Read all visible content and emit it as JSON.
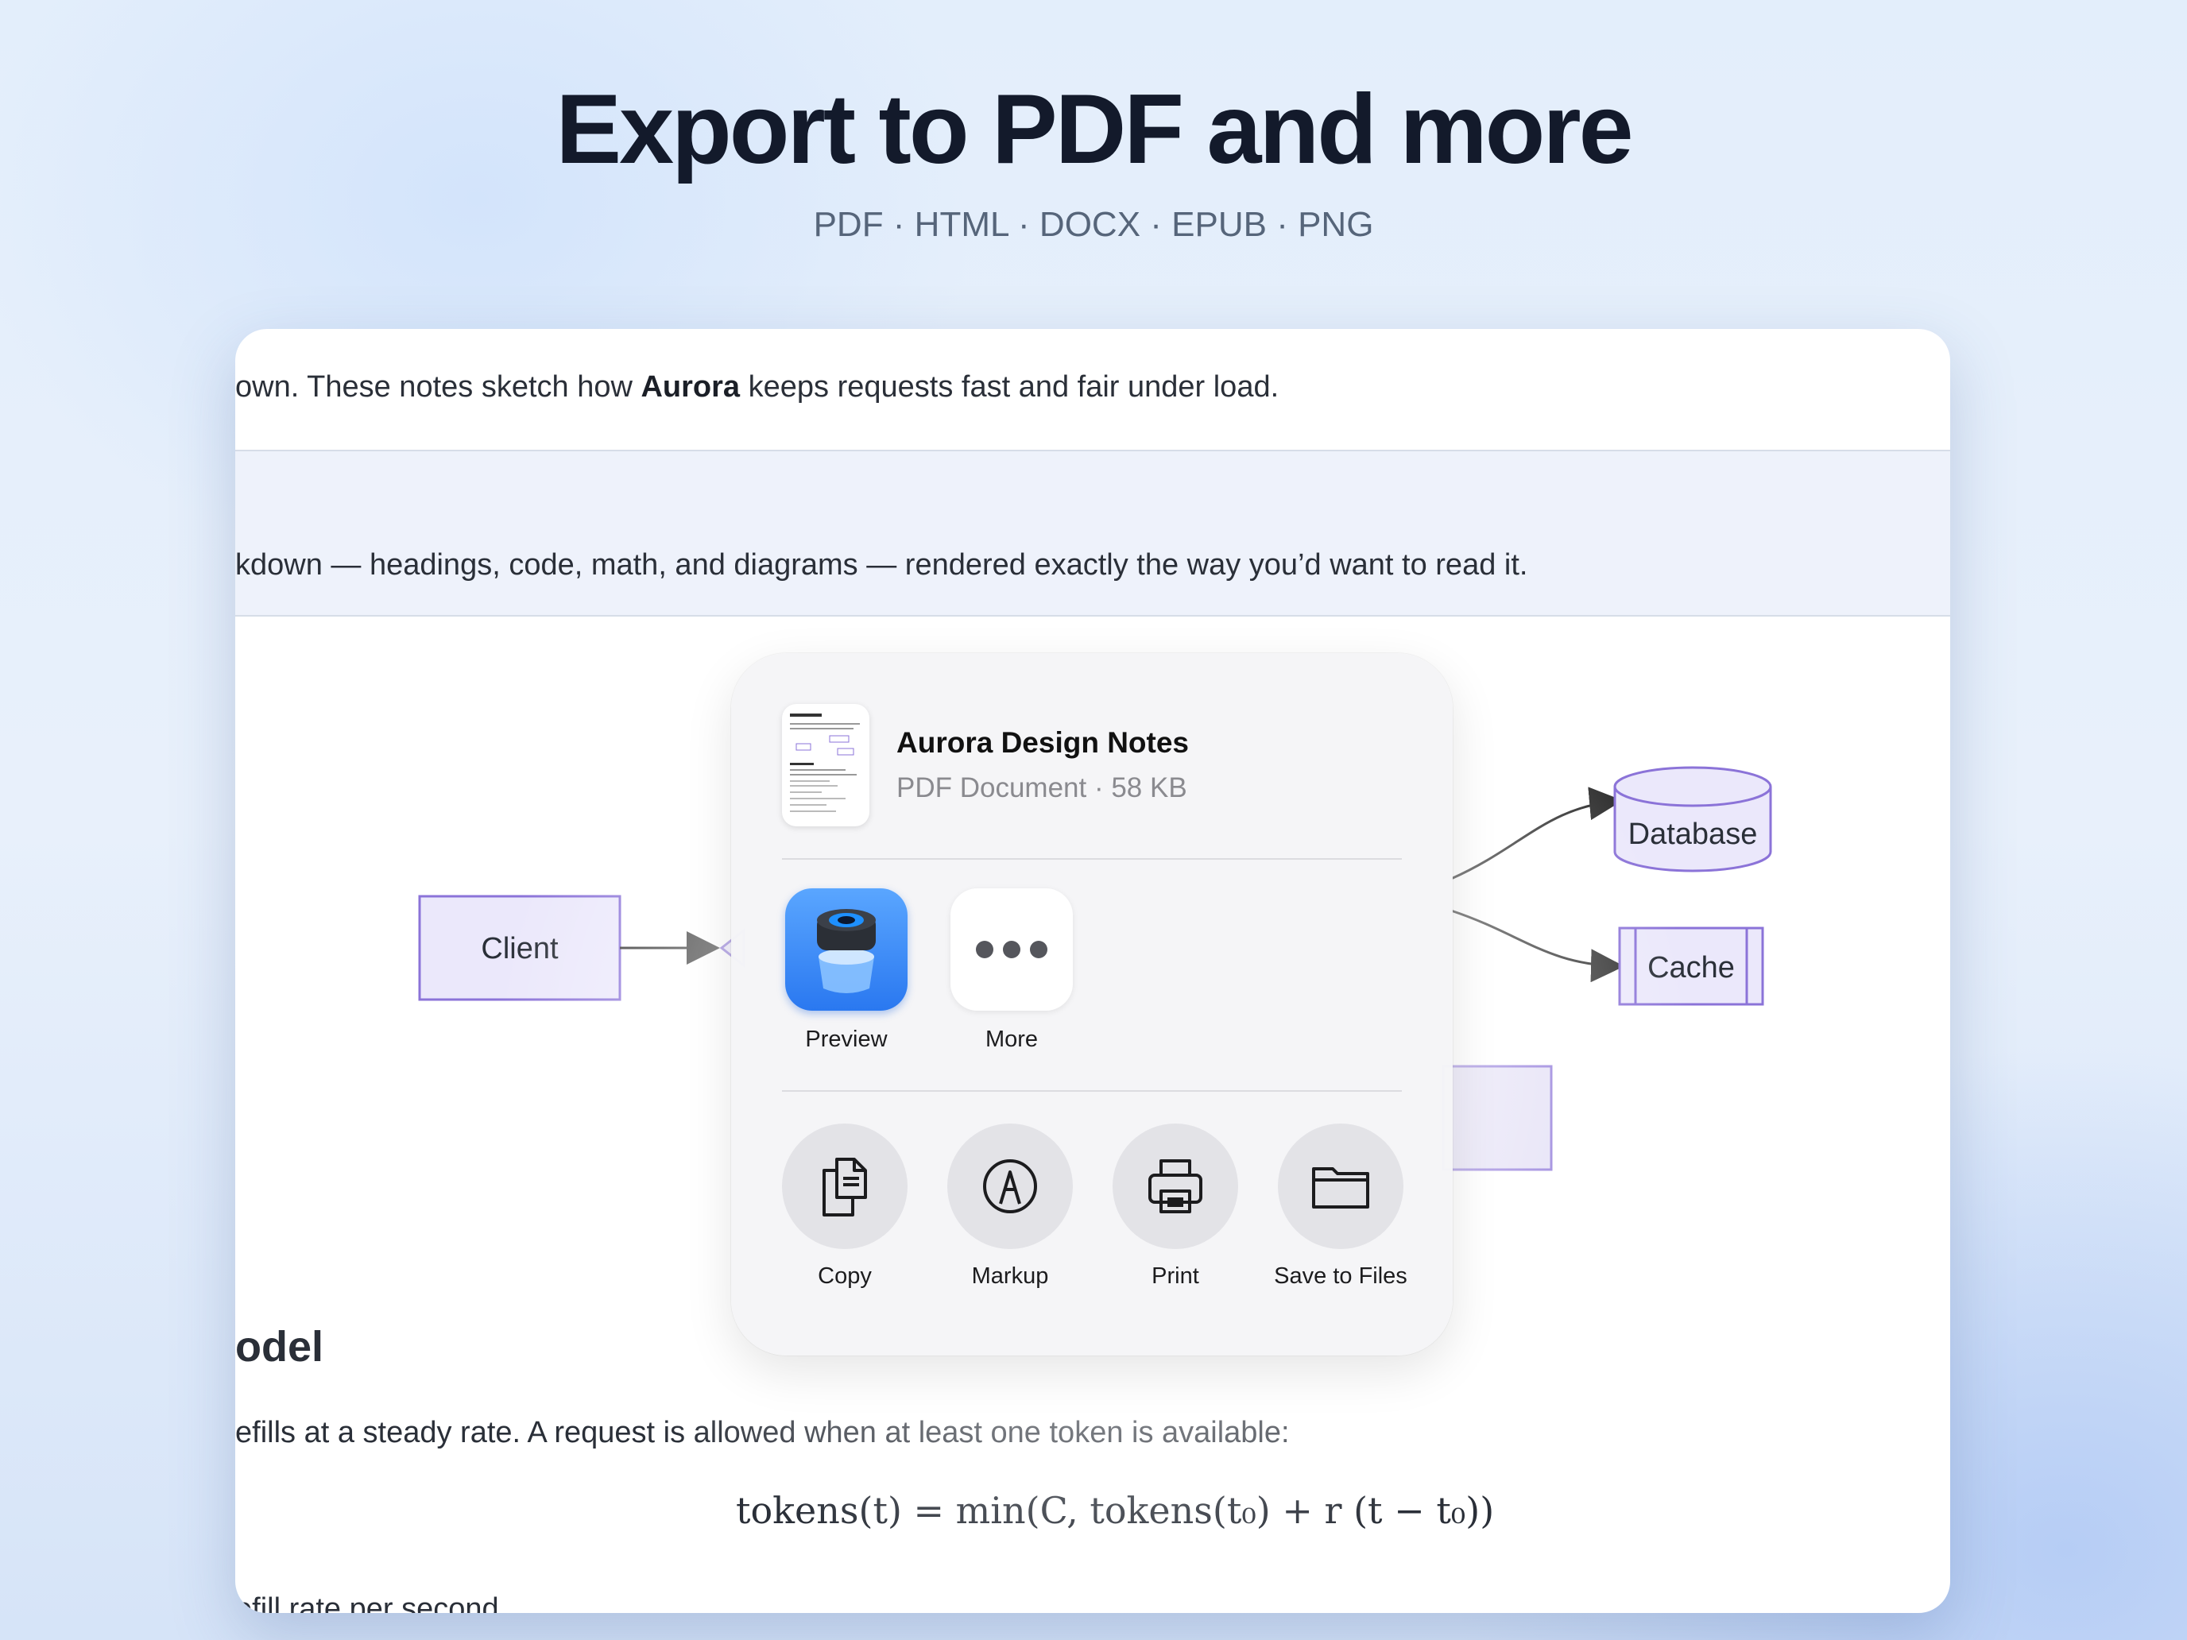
{
  "hero": {
    "title": "Export to PDF and more",
    "formats": "PDF · HTML · DOCX · EPUB · PNG"
  },
  "document": {
    "line1_before": "own. These notes sketch how ",
    "line1_bold": "Aurora",
    "line1_after": " keeps requests fast and fair under load.",
    "line2": "kdown — headings, code, math, and diagrams — rendered exactly the way you’d want to read it.",
    "diagram": {
      "client": "Client",
      "database": "Database",
      "cache": "Cache"
    },
    "heading": "odel",
    "paragraph": "efills at a steady rate. A request is allowed when at least one token is available:",
    "formula": "tokens(t) = min(C,  tokens(t₀) + r (t − t₀))",
    "cut_line": "efill rate per second"
  },
  "share_sheet": {
    "file_title": "Aurora Design Notes",
    "file_meta": "PDF Document · 58 KB",
    "apps": [
      {
        "label": "Preview",
        "icon": "preview-app-icon"
      },
      {
        "label": "More",
        "icon": "more-dots-icon"
      }
    ],
    "actions": [
      {
        "label": "Copy",
        "icon": "copy-icon"
      },
      {
        "label": "Markup",
        "icon": "markup-icon"
      },
      {
        "label": "Print",
        "icon": "print-icon"
      },
      {
        "label": "Save to Files",
        "icon": "folder-icon"
      }
    ]
  },
  "colors": {
    "node_fill": "#ebe8fb",
    "node_stroke": "#8b73d8",
    "title": "#131a2b"
  }
}
